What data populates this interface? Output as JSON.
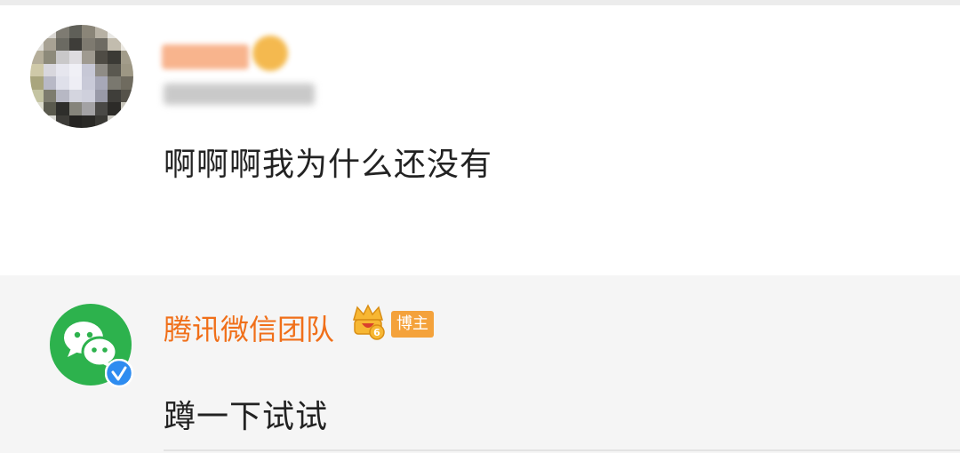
{
  "comment": {
    "avatar_icon": "blurred-user-avatar",
    "text": "啊啊啊我为什么还没有"
  },
  "reply": {
    "avatar_icon": "wechat-logo-icon",
    "verified_icon": "blue-verified-check-icon",
    "name": "腾讯微信团队",
    "level_icon": "crown-level-6-icon",
    "level": "6",
    "role_badge": "博主",
    "text": "蹲一下试试"
  },
  "colors": {
    "name": "#f06f19",
    "badge": "#f4a23b",
    "wechat_green": "#2db24d",
    "verified_blue": "#2e8cf0"
  }
}
